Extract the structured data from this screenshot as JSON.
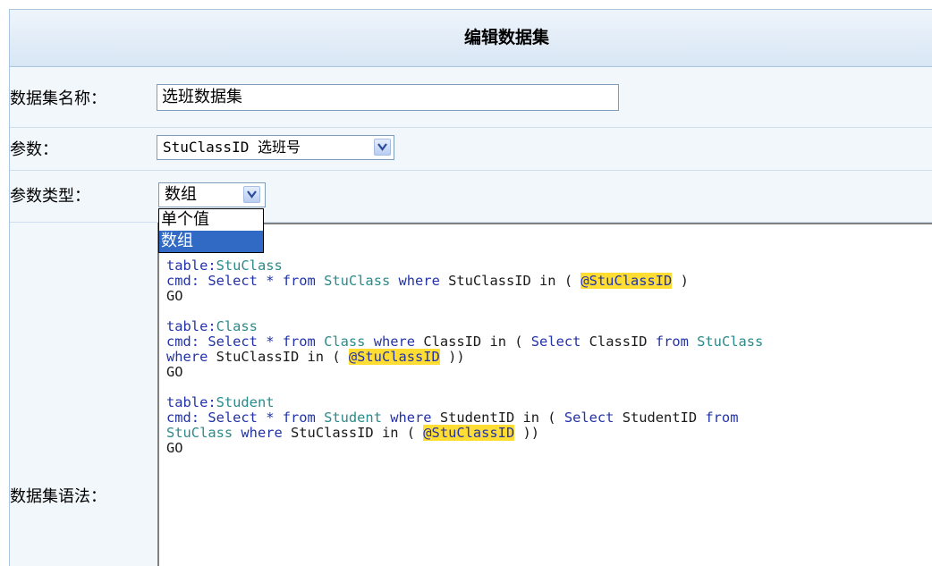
{
  "header": {
    "title": "编辑数据集"
  },
  "form": {
    "name_label": "数据集名称：",
    "name_value": "选班数据集",
    "param_label": "参数：",
    "param_value": "StuClassID 选班号",
    "param_type_label": "参数类型：",
    "param_type_value": "数组",
    "param_type_options": [
      "单个值",
      "数组"
    ],
    "syntax_label": "数据集语法："
  },
  "code_lines": [
    [
      {
        "t": "table:",
        "c": "kw"
      },
      {
        "t": "StuClass",
        "c": "tb"
      }
    ],
    [
      {
        "t": "cmd: Select * ",
        "c": "kw"
      },
      {
        "t": "from",
        "c": "kw"
      },
      {
        "t": " ",
        "c": ""
      },
      {
        "t": "StuClass",
        "c": "tb"
      },
      {
        "t": " where ",
        "c": "kw"
      },
      {
        "t": "StuClassID in ( ",
        "c": ""
      },
      {
        "t": "@StuClassID",
        "c": "pm"
      },
      {
        "t": " )",
        "c": ""
      }
    ],
    [
      {
        "t": "GO",
        "c": ""
      }
    ],
    [
      {
        "t": "",
        "c": ""
      }
    ],
    [
      {
        "t": "table:",
        "c": "kw"
      },
      {
        "t": "Class",
        "c": "tb"
      }
    ],
    [
      {
        "t": "cmd: Select * ",
        "c": "kw"
      },
      {
        "t": "from",
        "c": "kw"
      },
      {
        "t": " ",
        "c": ""
      },
      {
        "t": "Class",
        "c": "tb"
      },
      {
        "t": " where ",
        "c": "kw"
      },
      {
        "t": "ClassID in ( ",
        "c": ""
      },
      {
        "t": "Select ",
        "c": "kw"
      },
      {
        "t": "ClassID ",
        "c": ""
      },
      {
        "t": "from ",
        "c": "kw"
      },
      {
        "t": "StuClass",
        "c": "tb"
      }
    ],
    [
      {
        "t": "where ",
        "c": "kw"
      },
      {
        "t": "StuClassID in ( ",
        "c": ""
      },
      {
        "t": "@StuClassID",
        "c": "pm"
      },
      {
        "t": " ))",
        "c": ""
      }
    ],
    [
      {
        "t": "GO",
        "c": ""
      }
    ],
    [
      {
        "t": "",
        "c": ""
      }
    ],
    [
      {
        "t": "table:",
        "c": "kw"
      },
      {
        "t": "Student",
        "c": "tb"
      }
    ],
    [
      {
        "t": "cmd: Select * ",
        "c": "kw"
      },
      {
        "t": "from",
        "c": "kw"
      },
      {
        "t": " ",
        "c": ""
      },
      {
        "t": "Student",
        "c": "tb"
      },
      {
        "t": " where ",
        "c": "kw"
      },
      {
        "t": "StudentID in ( ",
        "c": ""
      },
      {
        "t": "Select ",
        "c": "kw"
      },
      {
        "t": "StudentID ",
        "c": ""
      },
      {
        "t": "from",
        "c": "kw"
      }
    ],
    [
      {
        "t": "StuClass",
        "c": "tb"
      },
      {
        "t": " where ",
        "c": "kw"
      },
      {
        "t": "StuClassID in ( ",
        "c": ""
      },
      {
        "t": "@StuClassID",
        "c": "pm"
      },
      {
        "t": " ))",
        "c": ""
      }
    ],
    [
      {
        "t": "GO",
        "c": ""
      }
    ]
  ],
  "icons": {
    "dropdown_arrow": "chevron-down-icon"
  },
  "colors": {
    "keyword": "#2233aa",
    "table": "#2b8a8a",
    "param_highlight": "#ffdd33",
    "selected_option": "#316ac5"
  }
}
